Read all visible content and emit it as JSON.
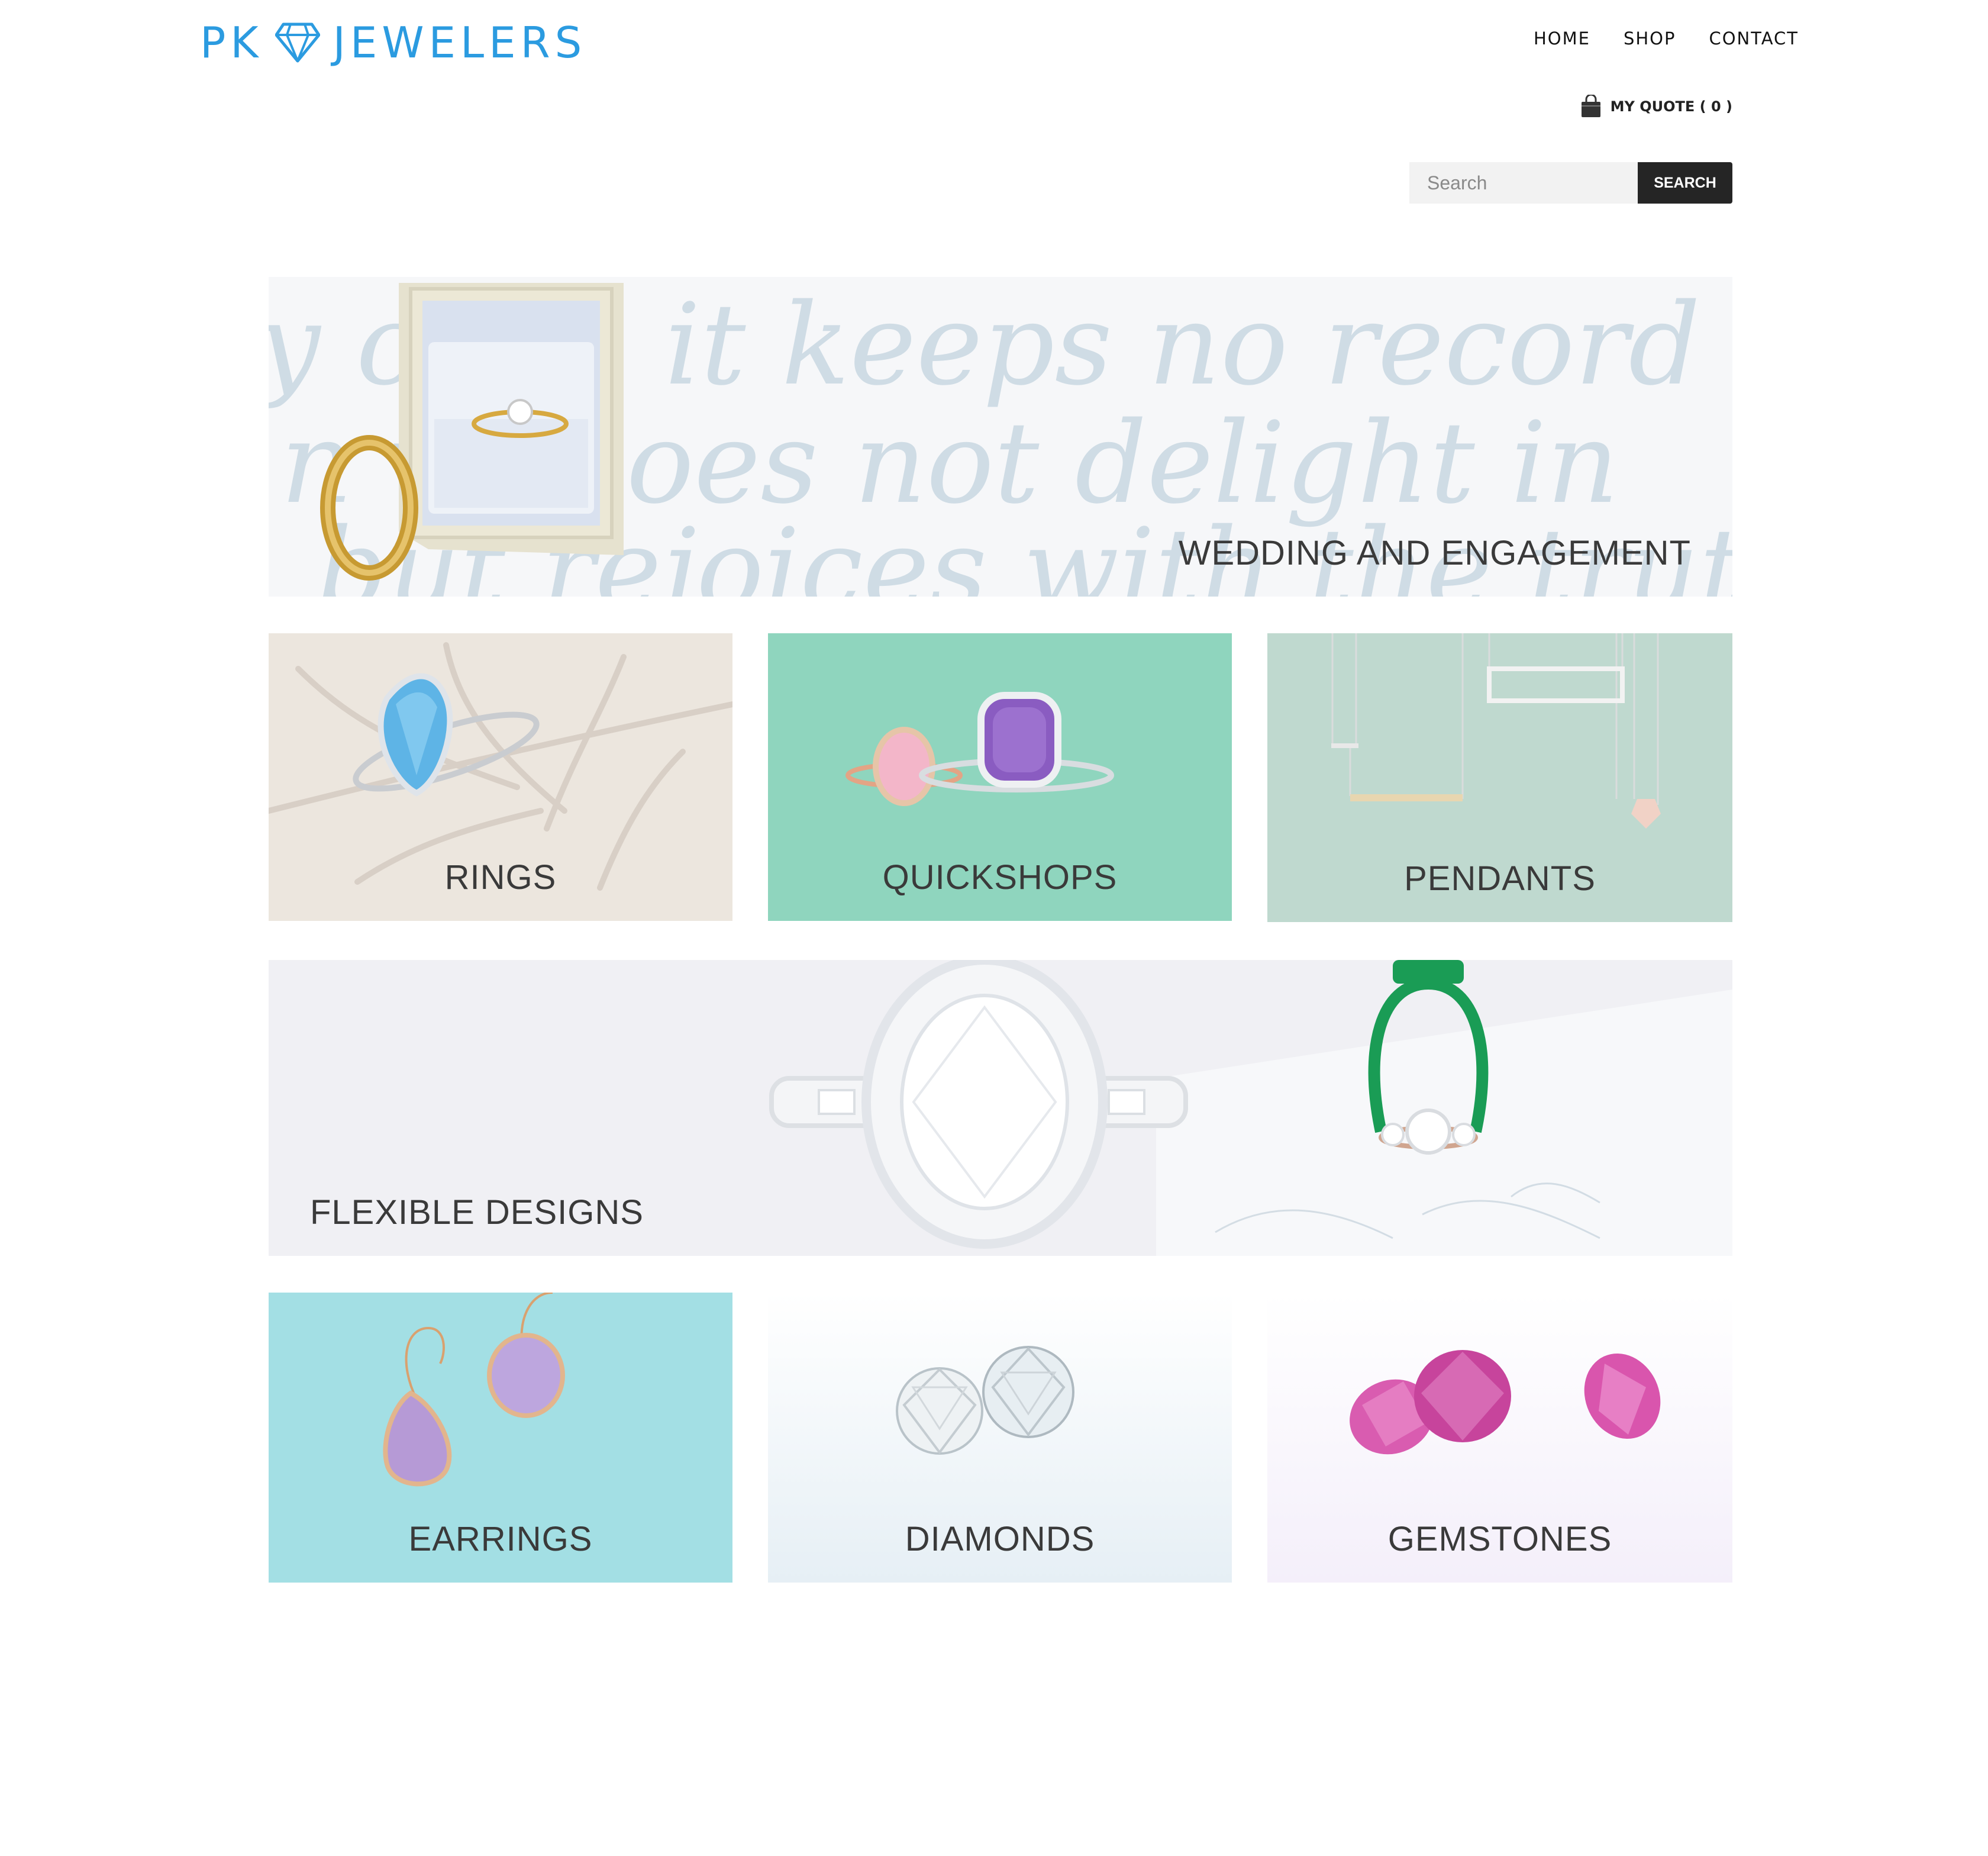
{
  "header": {
    "logo_left": "PK",
    "logo_right": "JEWELERS",
    "logo_icon": "diamond-icon",
    "nav": [
      {
        "label": "HOME"
      },
      {
        "label": "SHOP"
      },
      {
        "label": "CONTACT"
      }
    ],
    "quote": {
      "icon": "shopping-bag-icon",
      "label": "MY QUOTE ( 0 )"
    },
    "search": {
      "placeholder": "Search",
      "value": "",
      "button_label": "SEARCH"
    }
  },
  "tiles": {
    "wedding": {
      "label": "WEDDING AND ENGAGEMENT",
      "script_text": [
        "y c   ed, it keeps no record",
        "n   ve does not delight in",
        "but rejoices with the truth"
      ]
    },
    "rings": {
      "label": "RINGS"
    },
    "quickshops": {
      "label": "QUICKSHOPS"
    },
    "pendants": {
      "label": "PENDANTS"
    },
    "flexible": {
      "label": "FLEXIBLE DESIGNS"
    },
    "earrings": {
      "label": "EARRINGS"
    },
    "diamonds": {
      "label": "DIAMONDS"
    },
    "gemstones": {
      "label": "GEMSTONES"
    }
  },
  "colors": {
    "brand": "#2b9be0",
    "search_button": "#252525",
    "caption": "#3a3a3a"
  }
}
